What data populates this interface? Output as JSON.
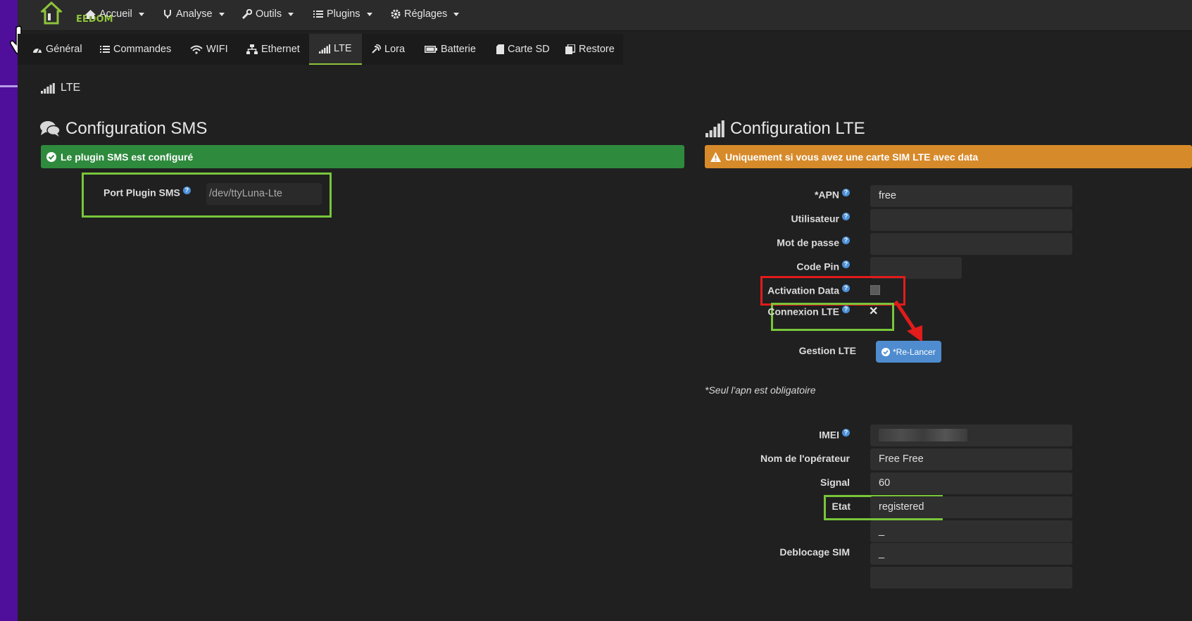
{
  "app": {
    "logo_text": "EEDOM"
  },
  "topnav": {
    "items": [
      {
        "label": "Accueil",
        "icon": "home-icon"
      },
      {
        "label": "Analyse",
        "icon": "stethoscope-icon"
      },
      {
        "label": "Outils",
        "icon": "wrench-icon"
      },
      {
        "label": "Plugins",
        "icon": "list-icon"
      },
      {
        "label": "Réglages",
        "icon": "gear-icon"
      }
    ]
  },
  "tabs": [
    {
      "label": "Général",
      "icon": "dashboard-icon"
    },
    {
      "label": "Commandes",
      "icon": "list-icon"
    },
    {
      "label": "WIFI",
      "icon": "wifi-icon"
    },
    {
      "label": "Ethernet",
      "icon": "network-icon"
    },
    {
      "label": "LTE",
      "icon": "signal-icon",
      "active": true
    },
    {
      "label": "Lora",
      "icon": "satellite-icon"
    },
    {
      "label": "Batterie",
      "icon": "battery-icon"
    },
    {
      "label": "Carte SD",
      "icon": "sd-card-icon"
    },
    {
      "label": "Restore",
      "icon": "copy-icon"
    }
  ],
  "section_tag": "LTE",
  "sms": {
    "heading": "Configuration SMS",
    "alert": "Le plugin SMS est configuré",
    "port_label": "Port Plugin SMS",
    "port_value": "/dev/ttyLuna-Lte"
  },
  "lte": {
    "heading": "Configuration LTE",
    "alert": "Uniquement si vous avez une carte SIM LTE avec data",
    "apn_label": "*APN",
    "apn_value": "free",
    "user_label": "Utilisateur",
    "user_value": "",
    "password_label": "Mot de passe",
    "password_value": "",
    "pin_label": "Code Pin",
    "pin_value": "",
    "activation_label": "Activation Data",
    "connexion_label": "Connexion LTE",
    "connexion_value": "✕",
    "gestion_label": "Gestion LTE",
    "relancer_label": "*Re-Lancer",
    "note": "*Seul l'apn est obligatoire",
    "imei_label": "IMEI",
    "operator_label": "Nom de l'opérateur",
    "operator_value": "Free Free",
    "signal_label": "Signal",
    "signal_value": "60",
    "etat_label": "Etat",
    "etat_value": "registered",
    "extra_value": "_",
    "sim_label": "Deblocage SIM",
    "sim_value": "_"
  },
  "colors": {
    "accent_green": "#78c63a",
    "alert_green": "#2e8a3d",
    "alert_orange": "#d78a2a",
    "button_blue": "#4e8ccf",
    "highlight_red": "#e21b1b"
  }
}
